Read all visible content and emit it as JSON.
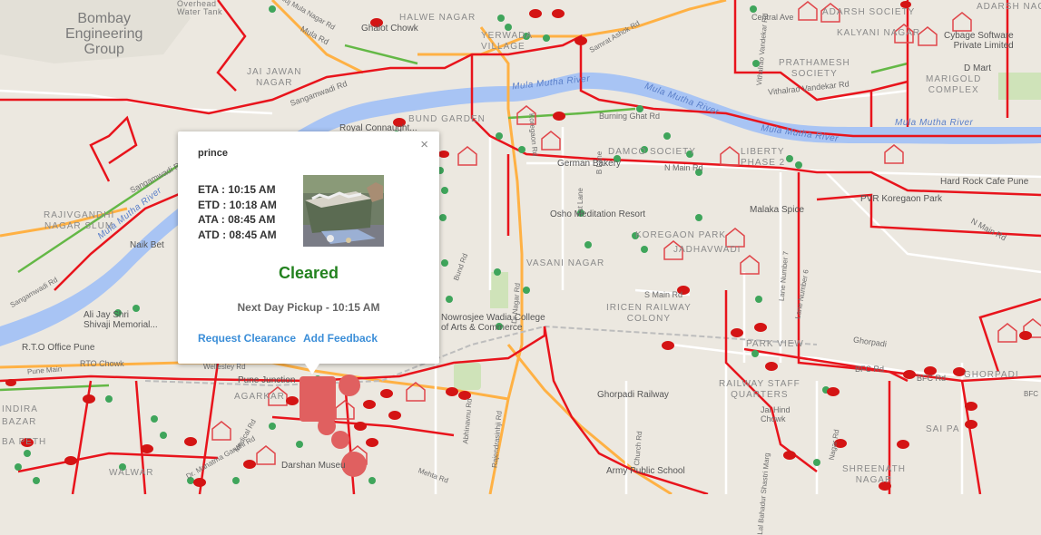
{
  "map": {
    "areas": [
      {
        "id": "bombay-eng",
        "text": "Bombay\nEngineering\nGroup"
      },
      {
        "id": "overhead",
        "text": "Overhead\nWater Tank"
      },
      {
        "id": "halwe",
        "text": "HALWE NAGAR"
      },
      {
        "id": "ghalot",
        "text": "Ghalot Chowk"
      },
      {
        "id": "yerwada",
        "text": "YERWADA\nVILLAGE"
      },
      {
        "id": "jai-jawan",
        "text": "JAI JAWAN\nNAGAR"
      },
      {
        "id": "rajivgandhi",
        "text": "RAJIVGANDHI\nNAGAR SLUM"
      },
      {
        "id": "naik-bet",
        "text": "Naik Bet"
      },
      {
        "id": "rto",
        "text": "R.T.O Office Pune"
      },
      {
        "id": "shivaji",
        "text": "Ali Jay Shri\nShivaji Memorial..."
      },
      {
        "id": "rto-chowk",
        "text": "RTO Chowk"
      },
      {
        "id": "agarkar",
        "text": "AGARKAR"
      },
      {
        "id": "bund",
        "text": "BUND GARDEN"
      },
      {
        "id": "royal",
        "text": "Royal Connaught..."
      },
      {
        "id": "damco",
        "text": "DAMCO SOCIETY"
      },
      {
        "id": "german",
        "text": "German Bakery"
      },
      {
        "id": "liberty",
        "text": "LIBERTY\nPHASE 2"
      },
      {
        "id": "osho",
        "text": "Osho Meditation Resort"
      },
      {
        "id": "koregaon-park",
        "text": "KOREGAON PARK"
      },
      {
        "id": "jadhav",
        "text": "JADHAVWADI"
      },
      {
        "id": "vasani",
        "text": "VASANI NAGAR"
      },
      {
        "id": "irican",
        "text": "IRICEN RAILWAY\nCOLONY"
      },
      {
        "id": "wadia",
        "text": "Nowrosjee Wadia College\nof Arts & Commerce"
      },
      {
        "id": "malaka",
        "text": "Malaka Spice"
      },
      {
        "id": "hard-rock",
        "text": "Hard Rock Cafe Pune"
      },
      {
        "id": "pvr",
        "text": "PVR Koregaon Park"
      },
      {
        "id": "kalyani",
        "text": "KALYANI NAGAR"
      },
      {
        "id": "adarsh-soc",
        "text": "ADARSH SOCIETY"
      },
      {
        "id": "adarsh-nagar",
        "text": "ADARSH NAGAR"
      },
      {
        "id": "cybage",
        "text": "Cybage Software\nPrivate Limited"
      },
      {
        "id": "dmart",
        "text": "D Mart"
      },
      {
        "id": "marigold",
        "text": "MARIGOLD\nCOMPLEX"
      },
      {
        "id": "prathamesh",
        "text": "PRATHAMESH\nSOCIETY"
      },
      {
        "id": "central-ave",
        "text": "Central Ave"
      },
      {
        "id": "ghorpadi-rly",
        "text": "Ghorpadi Railway"
      },
      {
        "id": "army-school",
        "text": "Army Public School"
      },
      {
        "id": "railway-staff",
        "text": "RAILWAY STAFF\nQUARTERS"
      },
      {
        "id": "jai-hind",
        "text": "Jai Hind\nChowk"
      },
      {
        "id": "sai-pa",
        "text": "SAI PA"
      },
      {
        "id": "ghorpadi",
        "text": "GHORPADI"
      },
      {
        "id": "sreenath",
        "text": "SHREENATH\nNAGAR"
      },
      {
        "id": "park-view",
        "text": "PARK VIEW"
      },
      {
        "id": "darshan",
        "text": "Darshan Museu"
      },
      {
        "id": "pune-junction",
        "text": "Pune Junction"
      },
      {
        "id": "pachh",
        "text": "BA PETH"
      },
      {
        "id": "bazar",
        "text": "BAZAR"
      },
      {
        "id": "indira",
        "text": "INDIRA"
      },
      {
        "id": "walwar",
        "text": "WALWAR"
      }
    ],
    "roads": [
      {
        "id": "mula-mutha-1",
        "text": "Mula Mutha River"
      },
      {
        "id": "mula-mutha-2",
        "text": "Mula Mutha River"
      },
      {
        "id": "mula-mutha-3",
        "text": "Mula Mutha River"
      },
      {
        "id": "mula-mutha-4",
        "text": "Mula Mutha River"
      },
      {
        "id": "mula-mutha-5",
        "text": "Mula Mutha River"
      },
      {
        "id": "sangamwadi",
        "text": "Sangamwadi Rd"
      },
      {
        "id": "sangamwadi-2",
        "text": "Sangamwadi Rd"
      },
      {
        "id": "burning-ghat",
        "text": "Burning Ghat Rd"
      },
      {
        "id": "n-main",
        "text": "N Main Rd"
      },
      {
        "id": "n-main-2",
        "text": "N Main Rd"
      },
      {
        "id": "s-main",
        "text": "S Main Rd"
      },
      {
        "id": "vithalrao",
        "text": "Vithalrao Vandekar Rd"
      },
      {
        "id": "ghorpadi-rd",
        "text": "Ghorpadi"
      },
      {
        "id": "bfc",
        "text": "BFC Rd"
      },
      {
        "id": "bfc-2",
        "text": "BFC Rd"
      },
      {
        "id": "mula-rd",
        "text": "Mula Rd"
      },
      {
        "id": "abhinav",
        "text": "Abhinavnu Rd"
      },
      {
        "id": "rajendra",
        "text": "Rajendrasinhji Rd"
      },
      {
        "id": "church",
        "text": "Church Rd"
      },
      {
        "id": "lal-bahadur",
        "text": "Lal Bahadur Shastri Marg"
      },
      {
        "id": "lane-7",
        "text": "Lane Number 7"
      },
      {
        "id": "lane-6",
        "text": "Lane Number 6"
      },
      {
        "id": "b-lane",
        "text": "B Lane"
      },
      {
        "id": "1st-lane",
        "text": "1st Lane"
      },
      {
        "id": "nagar-rd",
        "text": "Koregaon Rd"
      },
      {
        "id": "dr-nagar",
        "text": "Dr Nagar Rd"
      },
      {
        "id": "bund-rd",
        "text": "Bund Rd"
      },
      {
        "id": "ashok",
        "text": "Samrat Ashok Rd"
      },
      {
        "id": "akluj",
        "text": "Akluj Mula Nagar Rd"
      },
      {
        "id": "sangamwadi-3",
        "text": "Sangamwadi Rd"
      },
      {
        "id": "vithalrao-lane",
        "text": "Vithalrao Vandekar Rd"
      },
      {
        "id": "nagar-rd-2",
        "text": "Nagar Rd"
      },
      {
        "id": "mahatma",
        "text": "Dr. Mahatma Gandhi Rd"
      },
      {
        "id": "wellesley",
        "text": "Wellesley Rd"
      },
      {
        "id": "bfc-3",
        "text": "BFC"
      },
      {
        "id": "mehta",
        "text": "Mehta Rd"
      },
      {
        "id": "medical",
        "text": "Medical Rd"
      },
      {
        "id": "sangam-bridge",
        "text": "Pune Main"
      }
    ]
  },
  "popup": {
    "title": "prince",
    "close": "×",
    "eta": "ETA : 10:15 AM",
    "etd": "ETD : 10:18 AM",
    "ata": "ATA : 08:45 AM",
    "atd": "ATD : 08:45 AM",
    "status": "Cleared",
    "next_pickup": "Next Day Pickup - 10:15 AM",
    "request_clearance": "Request Clearance",
    "add_feedback": "Add Feedback"
  },
  "colors": {
    "route": "#e8141c",
    "river": "#a8c4f4",
    "major_road": "#ff9f2e",
    "minor_road": "#ffffff",
    "greenery": "#c5dfb0",
    "status_cleared": "#23821f",
    "link": "#3b8ed8"
  },
  "icons": {
    "bin_marker": "red-bin-icon",
    "bin_green": "green-bin-icon",
    "dustbin_house": "dustbin-house-icon",
    "truck": "truck-icon"
  }
}
